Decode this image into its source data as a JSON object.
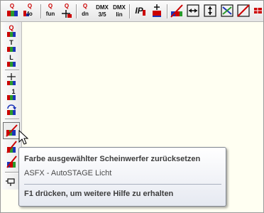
{
  "toolbar": {
    "items": [
      {
        "name": "fixture-q-icon",
        "top": "Q",
        "bottom": ""
      },
      {
        "name": "fixture-q-fo-icon",
        "top": "Q",
        "bottom": "fo"
      },
      {
        "name": "fixture-q-fun-icon",
        "top": "Q",
        "bottom": "fun"
      },
      {
        "name": "fixture-q-move-icon",
        "top": "Q",
        "bottom": ""
      },
      {
        "name": "fixture-q-dn-icon",
        "top": "Q",
        "bottom": "dn"
      },
      {
        "name": "dmx-3-5-icon",
        "top": "DMX",
        "bottom": "3/5"
      },
      {
        "name": "dmx-lin-icon",
        "top": "DMX",
        "bottom": "lin"
      },
      {
        "name": "ip-icon",
        "top": "IP",
        "bottom": ""
      },
      {
        "name": "add-fixture-icon",
        "top": "",
        "bottom": ""
      },
      {
        "name": "reset-color-icon",
        "top": "",
        "bottom": ""
      },
      {
        "name": "fit-width-icon",
        "top": "",
        "bottom": ""
      },
      {
        "name": "fit-height-icon",
        "top": "",
        "bottom": ""
      },
      {
        "name": "swap-icon",
        "top": "",
        "bottom": ""
      },
      {
        "name": "clear-icon",
        "top": "",
        "bottom": ""
      },
      {
        "name": "grid-icon",
        "top": "",
        "bottom": ""
      }
    ]
  },
  "sidebar": {
    "items": [
      {
        "name": "fixture-q-icon",
        "label": "Q"
      },
      {
        "name": "fixture-t-icon",
        "label": "T"
      },
      {
        "name": "fixture-l-icon",
        "label": "L"
      },
      {
        "name": "fixture-point-icon",
        "label": ""
      },
      {
        "name": "fixture-1-icon",
        "label": "1"
      },
      {
        "name": "fixture-rotate-icon",
        "label": ""
      },
      {
        "name": "reset-color-icon",
        "label": ""
      },
      {
        "name": "fixture-color-icon",
        "label": ""
      },
      {
        "name": "fixture-color-reset-icon",
        "label": ""
      },
      {
        "name": "pin-icon",
        "label": ""
      }
    ]
  },
  "tooltip": {
    "title": "Farbe ausgewählter Scheinwerfer zurücksetzen",
    "subtitle": "ASFX - AutoSTAGE Licht",
    "help": "F1 drücken, um weitere Hilfe zu erhalten"
  },
  "colors": {
    "canvas": "#fffff2",
    "accent_red": "#cc0000",
    "accent_blue": "#1b34b8",
    "accent_green": "#2a9a2a",
    "tooltip_bg": "#ffffff"
  }
}
